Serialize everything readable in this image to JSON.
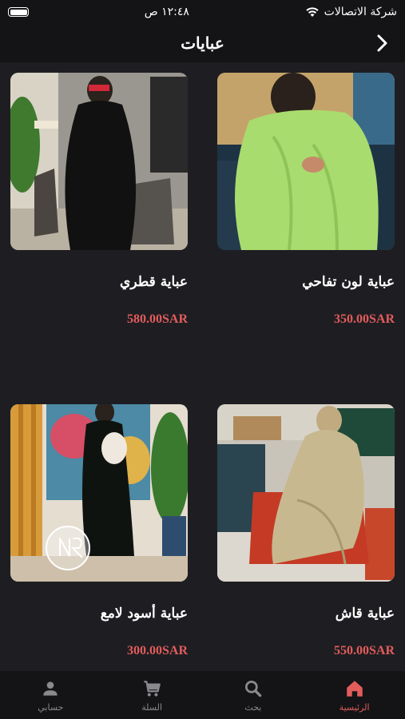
{
  "status": {
    "carrier": "شركة الاتصالات",
    "time": "١٢:٤٨ ص"
  },
  "header": {
    "title": "عبايات"
  },
  "products": [
    {
      "name": "عباية لون تفاحي",
      "price": "350.00SAR"
    },
    {
      "name": "عباية قطري",
      "price": "580.00SAR"
    },
    {
      "name": "عباية قاش",
      "price": "550.00SAR"
    },
    {
      "name": "عباية أسود لامع",
      "price": "300.00SAR"
    }
  ],
  "tabs": {
    "home": "الرئيسية",
    "search": "بحث",
    "cart": "السلة",
    "account": "حسابي"
  },
  "colors": {
    "accent": "#e25c5c",
    "background": "#1e1e22",
    "bar": "#141416"
  }
}
